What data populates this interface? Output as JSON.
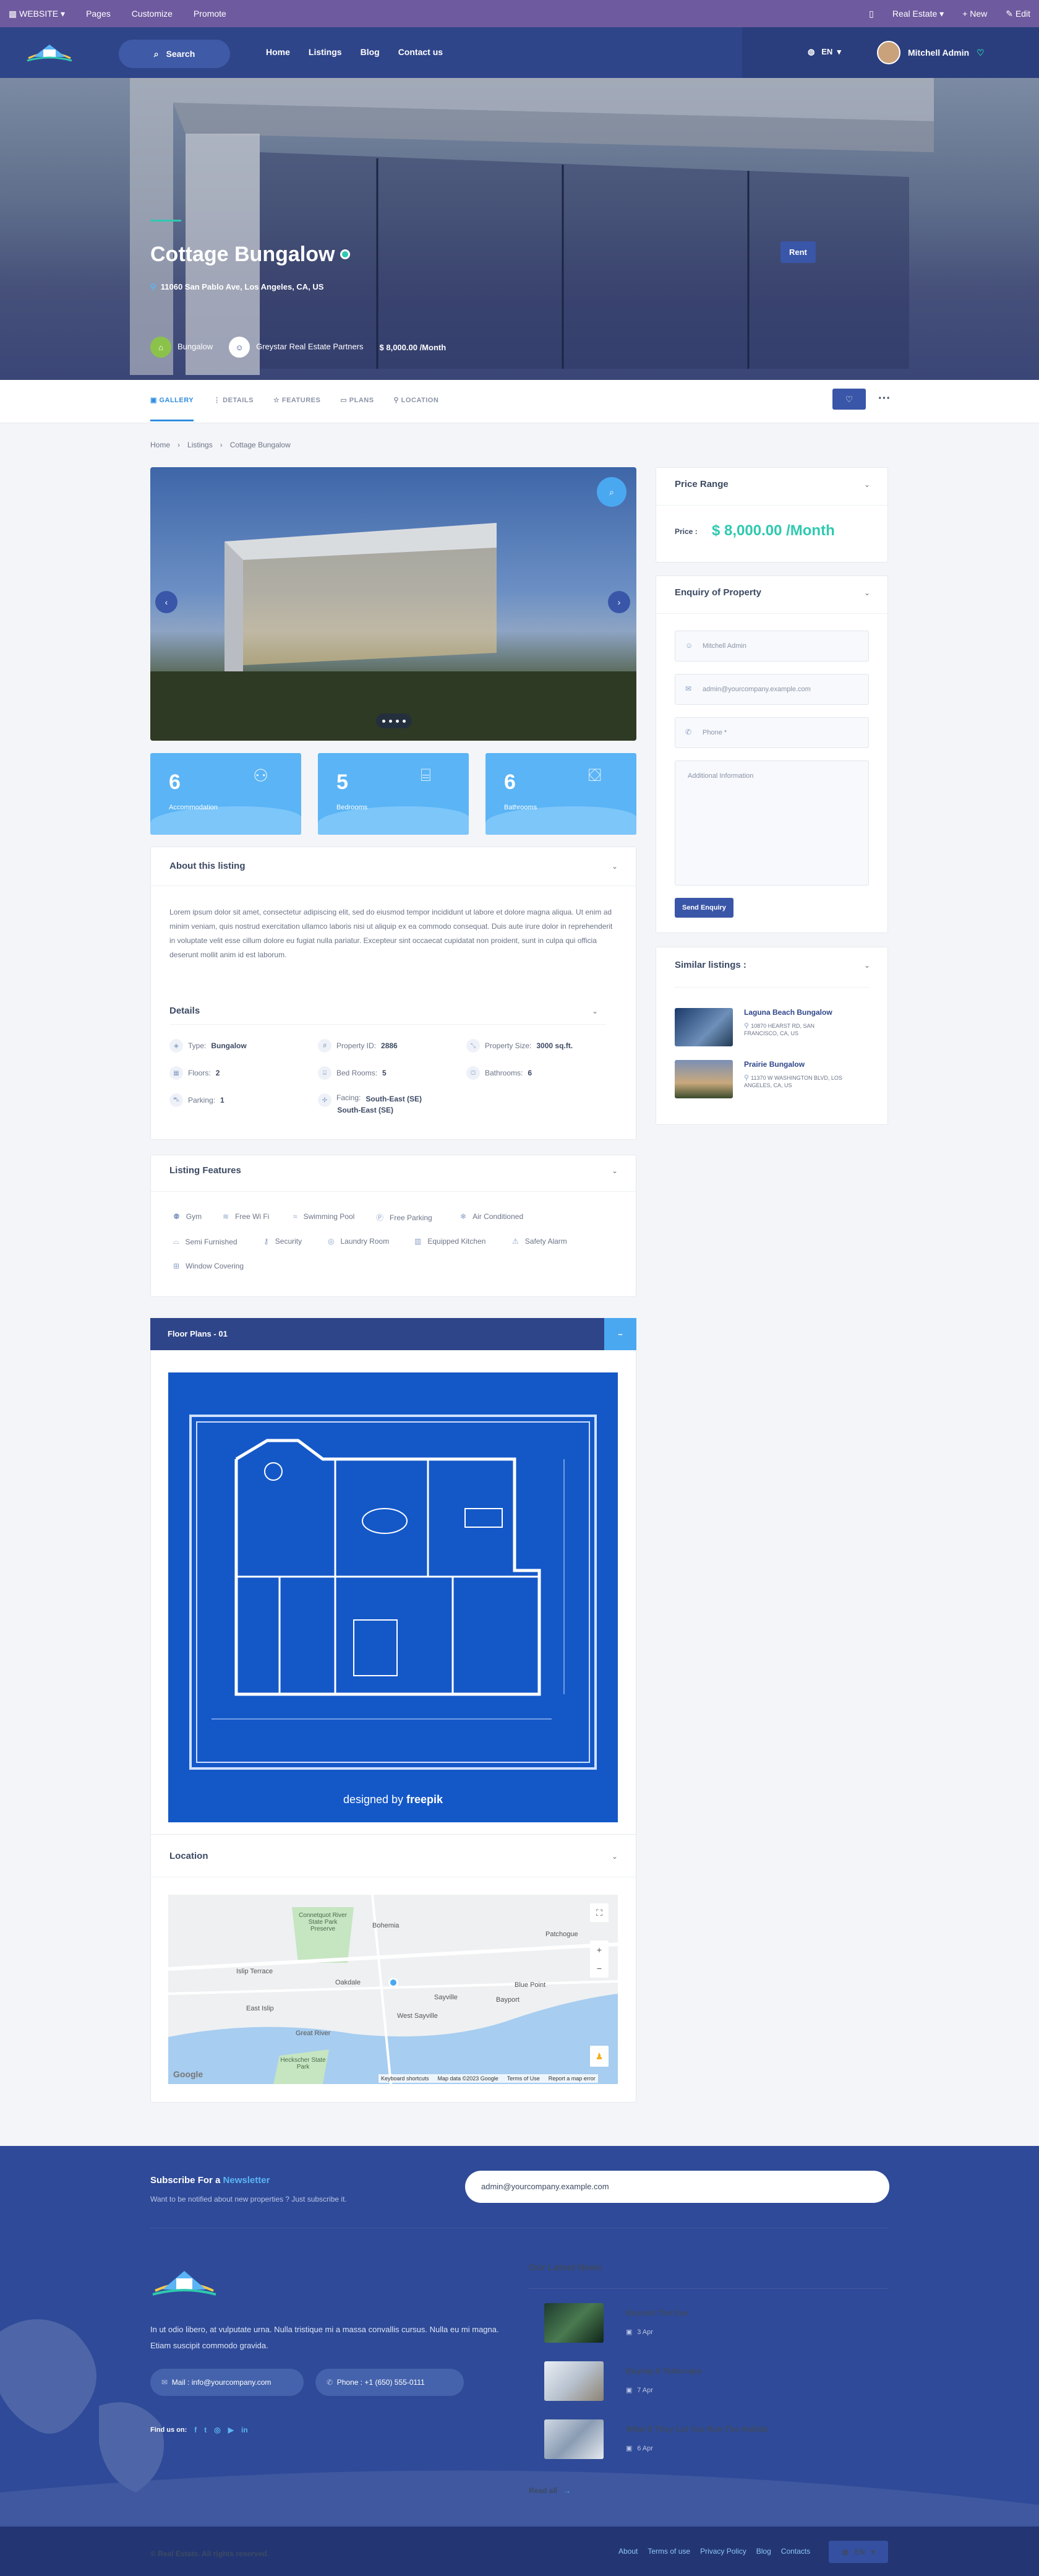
{
  "admin_bar": {
    "website": "WEBSITE",
    "pages": "Pages",
    "customize": "Customize",
    "promote": "Promote",
    "app": "Real Estate",
    "new": "+ New",
    "edit": "Edit"
  },
  "nav": {
    "search": "Search",
    "items": [
      "Home",
      "Listings",
      "Blog",
      "Contact us"
    ],
    "lang": "EN",
    "user": "Mitchell Admin"
  },
  "hero": {
    "title": "Cottage Bungalow",
    "address": "11060 San Pablo Ave, Los Angeles, CA, US",
    "badge": "Rent",
    "type": "Bungalow",
    "agency": "Greystar Real Estate Partners",
    "price": "$ 8,000.00 /Month"
  },
  "tabs": [
    "GALLERY",
    "DETAILS",
    "FEATURES",
    "PLANS",
    "LOCATION"
  ],
  "breadcrumb": [
    "Home",
    "Listings",
    "Cottage Bungalow"
  ],
  "stats": [
    {
      "num": "6",
      "label": "Accommodation"
    },
    {
      "num": "5",
      "label": "Bedrooms"
    },
    {
      "num": "6",
      "label": "Bathrooms"
    }
  ],
  "about": {
    "title": "About this listing",
    "text": "Lorem ipsum dolor sit amet, consectetur adipiscing elit, sed do eiusmod tempor incididunt ut labore et dolore magna aliqua. Ut enim ad minim veniam, quis nostrud exercitation ullamco laboris nisi ut aliquip ex ea commodo consequat. Duis aute irure dolor in reprehenderit in voluptate velit esse cillum dolore eu fugiat nulla pariatur. Excepteur sint occaecat cupidatat non proident, sunt in culpa qui officia deserunt mollit anim id est laborum."
  },
  "details": {
    "title": "Details",
    "type_label": "Type:",
    "type": "Bungalow",
    "id_label": "Property ID:",
    "id": "2886",
    "size_label": "Property Size:",
    "size": "3000 sq.ft.",
    "floors_label": "Floors:",
    "floors": "2",
    "bed_label": "Bed Rooms:",
    "bed": "5",
    "bath_label": "Bathrooms:",
    "bath": "6",
    "parking_label": "Parking:",
    "parking": "1",
    "facing_label": "Facing:",
    "facing": "South-East (SE)",
    "facing2": "South-East (SE)"
  },
  "features": {
    "title": "Listing Features",
    "items": [
      "Gym",
      "Free Wi Fi",
      "Swimming Pool",
      "Free Parking",
      "Air Conditioned",
      "Semi Furnished",
      "Security",
      "Laundry Room",
      "Equipped Kitchen",
      "Safety Alarm",
      "Window Covering"
    ]
  },
  "floor": {
    "title": "Floor Plans - 01",
    "credit": "designed by",
    "brand": "freepik"
  },
  "location": {
    "title": "Location",
    "places": [
      "Connetquot River State Park Preserve",
      "Bohemia",
      "Patchogue",
      "Islip Terrace",
      "Oakdale",
      "Blue Point",
      "Sayville",
      "Bayport",
      "East Islip",
      "West Sayville",
      "Great River",
      "Heckscher State Park"
    ],
    "attribution": [
      "Keyboard shortcuts",
      "Map data ©2023 Google",
      "Terms of Use",
      "Report a map error"
    ],
    "google": "Google"
  },
  "price_range": {
    "title": "Price Range",
    "label": "Price :",
    "value": "$ 8,000.00 /Month"
  },
  "enquiry": {
    "title": "Enquiry of Property",
    "name": "Mitchell Admin",
    "email": "admin@yourcompany.example.com",
    "phone": "Phone *",
    "info": "Additional Information",
    "button": "Send Enquiry"
  },
  "similar": {
    "title": "Similar listings :",
    "items": [
      {
        "name": "Laguna Beach Bungalow",
        "addr1": "10870 HEARST RD, SAN",
        "addr2": "FRANCISCO, CA, US"
      },
      {
        "name": "Prairie Bungalow",
        "addr1": "11370 W WASHINGTON BLVD, LOS",
        "addr2": "ANGELES, CA, US"
      }
    ]
  },
  "footer": {
    "subscribe_a": "Subscribe For a",
    "subscribe_b": "Newsletter",
    "subscribe_sub": "Want to be notified about new properties ? Just subscribe it.",
    "email_value": "admin@yourcompany.example.com",
    "about": "In ut odio libero, at vulputate urna. Nulla tristique mi a massa convallis cursus. Nulla eu mi magna. Etiam suscipit commodo gravida.",
    "mail": "Mail : info@yourcompany.com",
    "phone": "Phone : +1 (650) 555-0111",
    "find": "Find us on:",
    "news_title": "Our Latest News",
    "news": [
      {
        "title": "Beyond The Eye",
        "date": "3 Apr"
      },
      {
        "title": "Buying A Telescope",
        "date": "7 Apr"
      },
      {
        "title": "What If They Let You Run The Hubble",
        "date": "6 Apr"
      }
    ],
    "read_all": "Read all",
    "copyright": "© Real Estate. All rights reserved.",
    "links": [
      "About",
      "Terms of use",
      "Privacy Policy",
      "Blog",
      "Contacts"
    ],
    "lang": "EN"
  },
  "colors": {
    "primary": "#2f4589",
    "accent": "#5ab4f5",
    "price": "#2fc9b0"
  }
}
